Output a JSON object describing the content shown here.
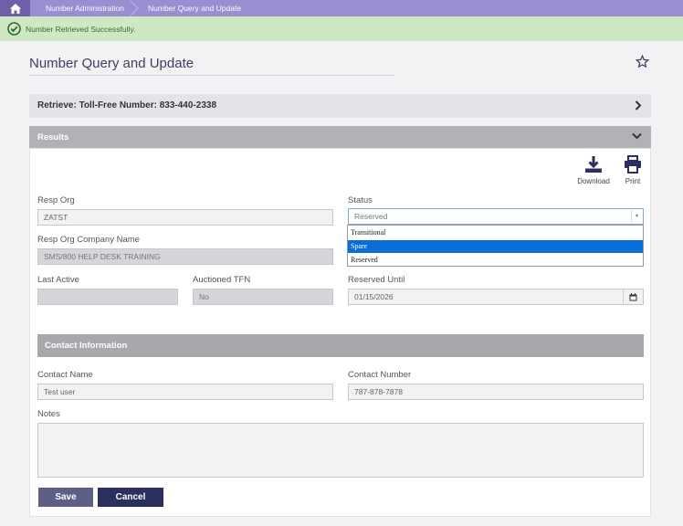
{
  "breadcrumb": {
    "items": [
      "Number Administration",
      "Number Query and Update"
    ]
  },
  "alert": {
    "message": "Number Retrieved Successfully."
  },
  "page": {
    "title": "Number Query and Update"
  },
  "retrieve": {
    "label": "Retrieve: Toll-Free Number: 833-440-2338"
  },
  "results": {
    "label": "Results",
    "download_label": "Download",
    "print_label": "Print"
  },
  "form": {
    "resp_org_label": "Resp Org",
    "resp_org_value": "ZATST",
    "status_label": "Status",
    "status_value": "Reserved",
    "status_options": [
      "Transitional",
      "Spare",
      "Reserved"
    ],
    "status_highlighted": "Spare",
    "company_label": "Resp Org Company Name",
    "company_value": "SMS/800 HELP DESK TRAINING",
    "last_active_label": "Last Active",
    "last_active_value": "",
    "auctioned_label": "Auctioned TFN",
    "auctioned_value": "No",
    "reserved_until_label": "Reserved Until",
    "reserved_until_value": "01/15/2026"
  },
  "contact": {
    "section_label": "Contact Information",
    "name_label": "Contact Name",
    "name_value": "Test user",
    "number_label": "Contact Number",
    "number_value": "787-878-7878",
    "notes_label": "Notes",
    "notes_value": ""
  },
  "actions": {
    "save_label": "Save",
    "cancel_label": "Cancel"
  },
  "colors": {
    "topbar": "#9b8dd1",
    "alert_bg": "#cfe8c4",
    "select_highlight": "#0a6cd6",
    "cancel_button": "#2b2f5e"
  }
}
